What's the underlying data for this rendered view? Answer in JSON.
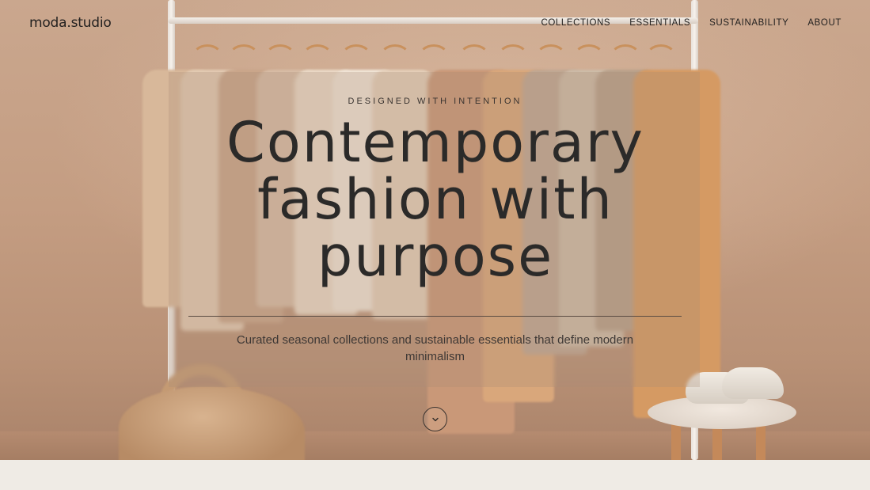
{
  "brand": {
    "logo": "moda.studio"
  },
  "nav": {
    "items": [
      {
        "label": "COLLECTIONS"
      },
      {
        "label": "ESSENTIALS"
      },
      {
        "label": "SUSTAINABILITY"
      },
      {
        "label": "ABOUT"
      }
    ]
  },
  "hero": {
    "eyebrow": "DESIGNED WITH INTENTION",
    "headline_line1": "Contemporary",
    "headline_line2": "fashion with",
    "headline_line3": "purpose",
    "subtitle": "Curated seasonal collections and sustainable essentials that define modern minimalism",
    "scroll_icon": "chevron-down-icon"
  },
  "colors": {
    "background": "#efebe5",
    "text": "#2b2a29",
    "hero_tone": "#c49d82"
  }
}
